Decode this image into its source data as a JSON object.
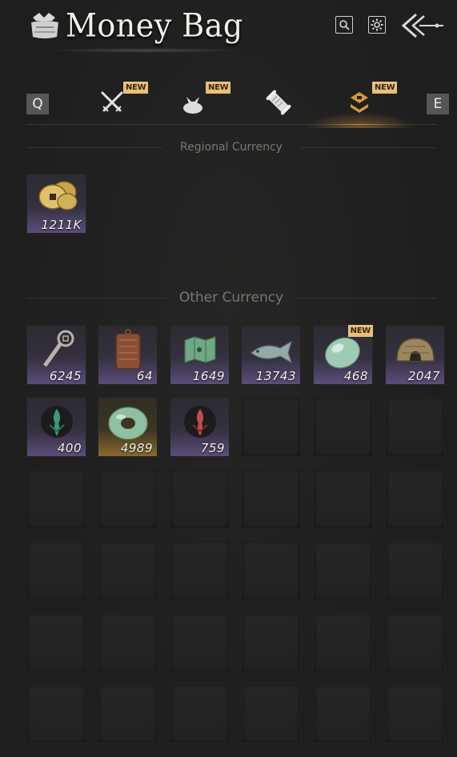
{
  "header": {
    "title": "Money Bag",
    "icons": [
      "money-bag-icon",
      "search-icon",
      "gear-icon",
      "back-arrow-icon"
    ]
  },
  "tabs": {
    "left_key": "Q",
    "right_key": "E",
    "items": [
      {
        "name": "weapons",
        "icon": "crossed-swords-icon",
        "new": "NEW"
      },
      {
        "name": "bundles",
        "icon": "cloth-bundle-icon",
        "new": "NEW"
      },
      {
        "name": "scrolls",
        "icon": "scroll-icon",
        "new": ""
      },
      {
        "name": "currency",
        "icon": "currency-icon",
        "new": "NEW",
        "active": true
      }
    ]
  },
  "regional": {
    "heading": "Regional Currency",
    "items": [
      {
        "name": "coin-strings",
        "icon": "coins-icon",
        "qty": "1211K"
      }
    ]
  },
  "other": {
    "heading": "Other Currency",
    "items": [
      {
        "name": "key-token",
        "icon": "key-icon",
        "qty": "6245"
      },
      {
        "name": "bronze-plaque",
        "icon": "plaque-icon",
        "qty": "64"
      },
      {
        "name": "jade-map",
        "icon": "map-icon",
        "qty": "1649"
      },
      {
        "name": "jade-fish",
        "icon": "fish-icon",
        "qty": "13743"
      },
      {
        "name": "jade-stone",
        "icon": "jade-stone-icon",
        "qty": "468",
        "new": "NEW"
      },
      {
        "name": "bronze-mirror",
        "icon": "mirror-icon",
        "qty": "2047"
      },
      {
        "name": "green-flame",
        "icon": "green-flame-icon",
        "qty": "400"
      },
      {
        "name": "jade-disc",
        "icon": "jade-disc-icon",
        "qty": "4989"
      },
      {
        "name": "red-flame",
        "icon": "red-flame-icon",
        "qty": "759"
      }
    ]
  },
  "colors": {
    "accent": "#d6963c",
    "new_badge": "#e8c07a",
    "background": "#1e1e1e",
    "slot_rarity_purple": "#5b4e7a",
    "slot_rarity_gold": "#8a6a2c"
  }
}
